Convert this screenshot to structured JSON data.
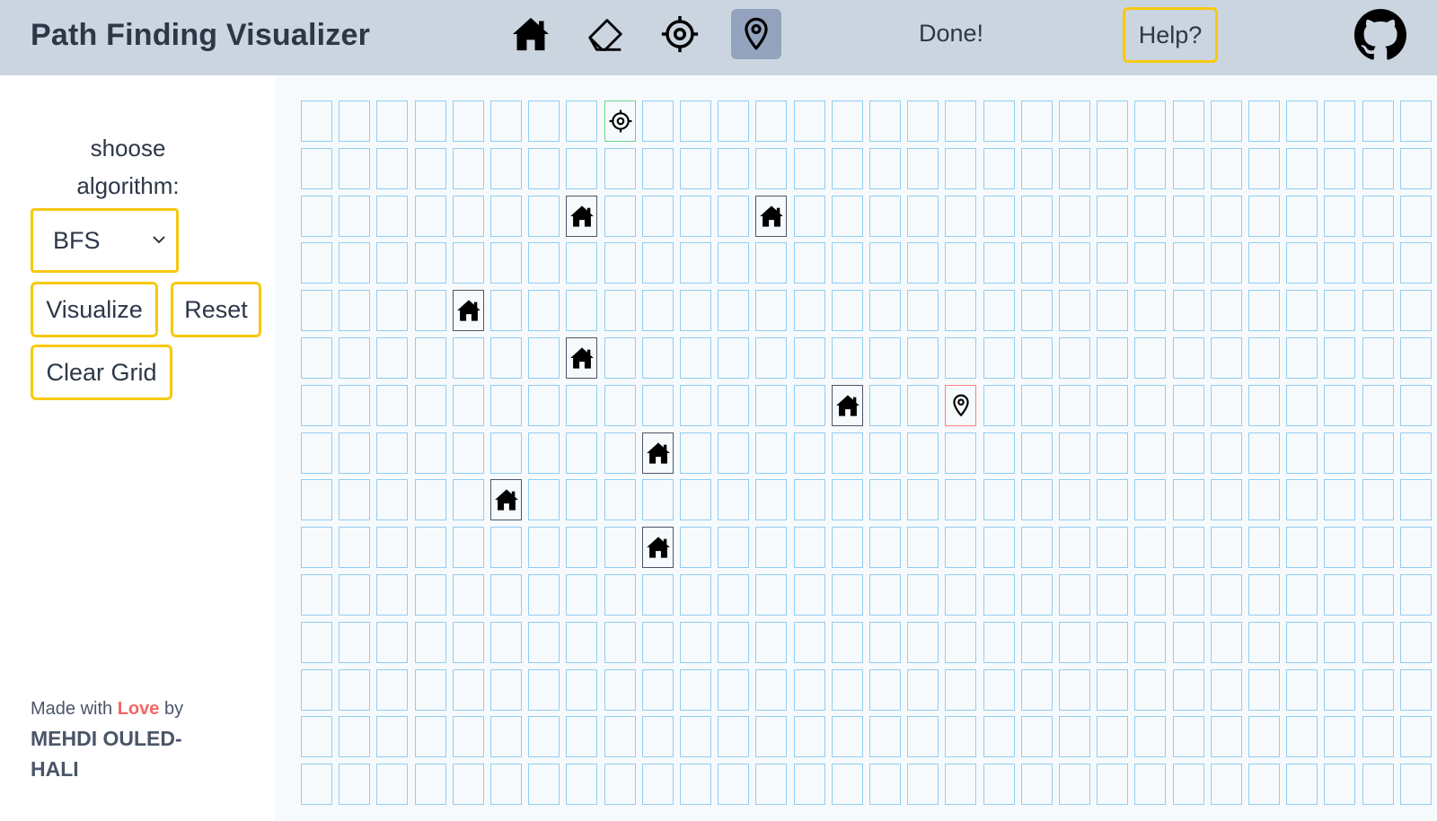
{
  "header": {
    "title": "Path Finding Visualizer",
    "tools": [
      {
        "name": "wall-tool",
        "icon": "house-icon",
        "active": false
      },
      {
        "name": "eraser-tool",
        "icon": "eraser-icon",
        "active": false
      },
      {
        "name": "start-tool",
        "icon": "crosshair-icon",
        "active": false
      },
      {
        "name": "target-tool",
        "icon": "map-pin-icon",
        "active": true
      }
    ],
    "status": "Done!",
    "help_label": "Help?",
    "github_icon": "github-icon"
  },
  "sidebar": {
    "algo_label": "shoose algorithm:",
    "algorithm": {
      "selected": "BFS"
    },
    "visualize_label": "Visualize",
    "reset_label": "Reset",
    "clear_label": "Clear Grid",
    "credit": {
      "prefix": "Made with ",
      "love": "Love",
      "suffix": " by",
      "author": "MEHDI OULED-HALI"
    }
  },
  "grid": {
    "rows": 15,
    "cols": 30,
    "start": [
      0,
      8
    ],
    "target": [
      6,
      17
    ],
    "walls": [
      [
        2,
        7
      ],
      [
        2,
        12
      ],
      [
        4,
        4
      ],
      [
        5,
        7
      ],
      [
        6,
        14
      ],
      [
        7,
        9
      ],
      [
        8,
        5
      ],
      [
        9,
        9
      ]
    ]
  },
  "colors": {
    "header_bg": "#cbd5e0",
    "accent_yellow": "#f6c90e",
    "cell_border": "#90cdf4",
    "start_border": "#68d391",
    "target_border": "#fc8181",
    "love": "#f56565"
  }
}
